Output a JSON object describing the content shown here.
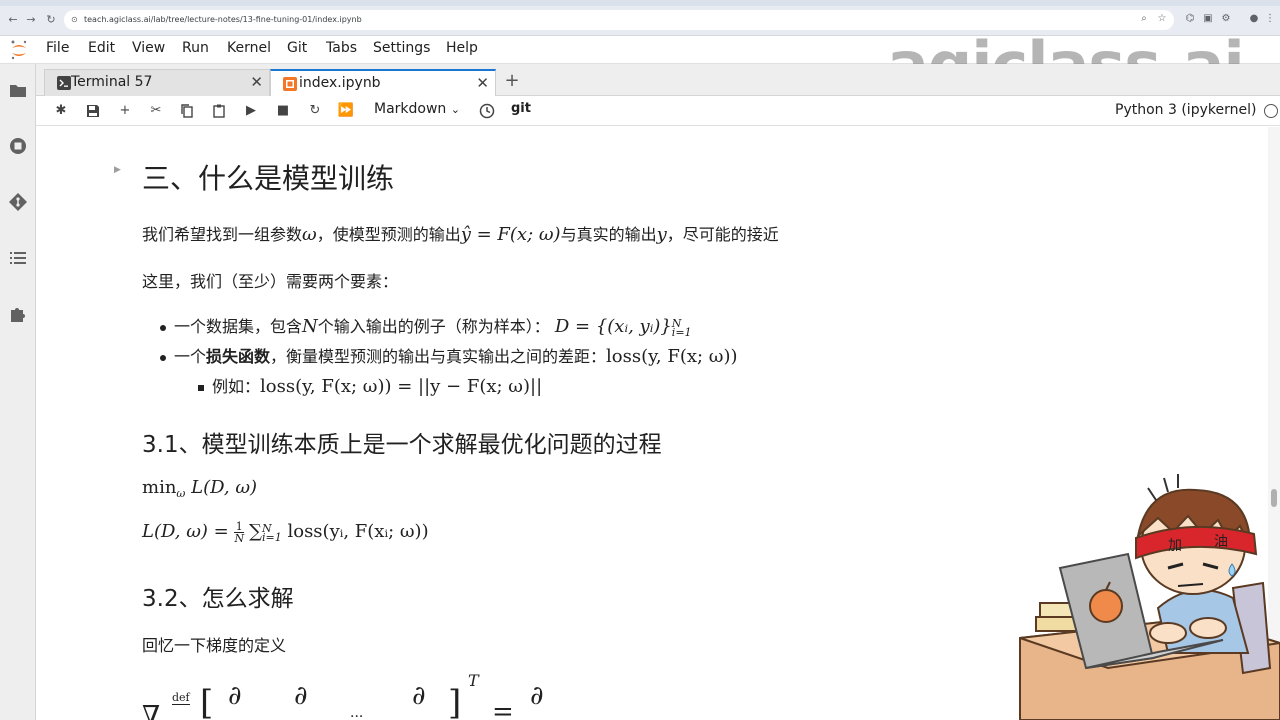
{
  "browser": {
    "url": "teach.agiclass.ai/lab/tree/lecture-notes/13-fine-tuning-01/index.ipynb"
  },
  "menu": [
    "File",
    "Edit",
    "View",
    "Run",
    "Kernel",
    "Git",
    "Tabs",
    "Settings",
    "Help"
  ],
  "tabs": [
    {
      "label": "Terminal 57"
    },
    {
      "label": "index.ipynb"
    }
  ],
  "toolbar": {
    "cell_type": "Markdown",
    "git": "git",
    "kernel": "Python 3 (ipykernel)"
  },
  "watermark": "agiclass.ai",
  "notebook": {
    "h2_title": "三、什么是模型训练",
    "intro_pre": "我们希望找到一组参数",
    "intro_omega": "ω",
    "intro_mid": "，使模型预测的输出",
    "intro_eq": "ŷ = F(x; ω)",
    "intro_post": "与真实的输出",
    "intro_y": "y",
    "intro_end": "，尽可能的接近",
    "here_text": "这里，我们（至少）需要两个要素：",
    "bullet1_pre": "一个数据集，包含",
    "bullet1_N": "N",
    "bullet1_post": "个输入输出的例子（称为样本）：",
    "bullet1_math": "D = {(xᵢ, yᵢ)}",
    "bullet1_sup": "N",
    "bullet1_sub": "i=1",
    "bullet2_pre": "一个",
    "bullet2_bold": "损失函数",
    "bullet2_post": "，衡量模型预测的输出与真实输出之间的差距：",
    "bullet2_math": "loss(y, F(x; ω))",
    "sub_pre": "例如：",
    "sub_math": "loss(y, F(x; ω)) = ||y − F(x; ω)||",
    "h3_1": "3.1、模型训练本质上是一个求解最优化问题的过程",
    "min_math": "min",
    "min_sub": "ω",
    "min_rest": " L(D, ω)",
    "loss_lhs": "L(D, ω) = ",
    "loss_frac_num": "1",
    "loss_frac_den": "N",
    "loss_sum": "∑",
    "loss_sum_sup": "N",
    "loss_sum_sub": "i=1",
    "loss_rest": " loss(yᵢ, F(xᵢ; ω))",
    "h3_2": "3.2、怎么求解",
    "recall": "回忆一下梯度的定义",
    "grad_nabla": "∇",
    "grad_def": "def",
    "grad_partial": "∂",
    "grad_T": "T",
    "grad_eq": "="
  },
  "mascot": {
    "headband_text_1": "加",
    "headband_text_2": "油"
  }
}
